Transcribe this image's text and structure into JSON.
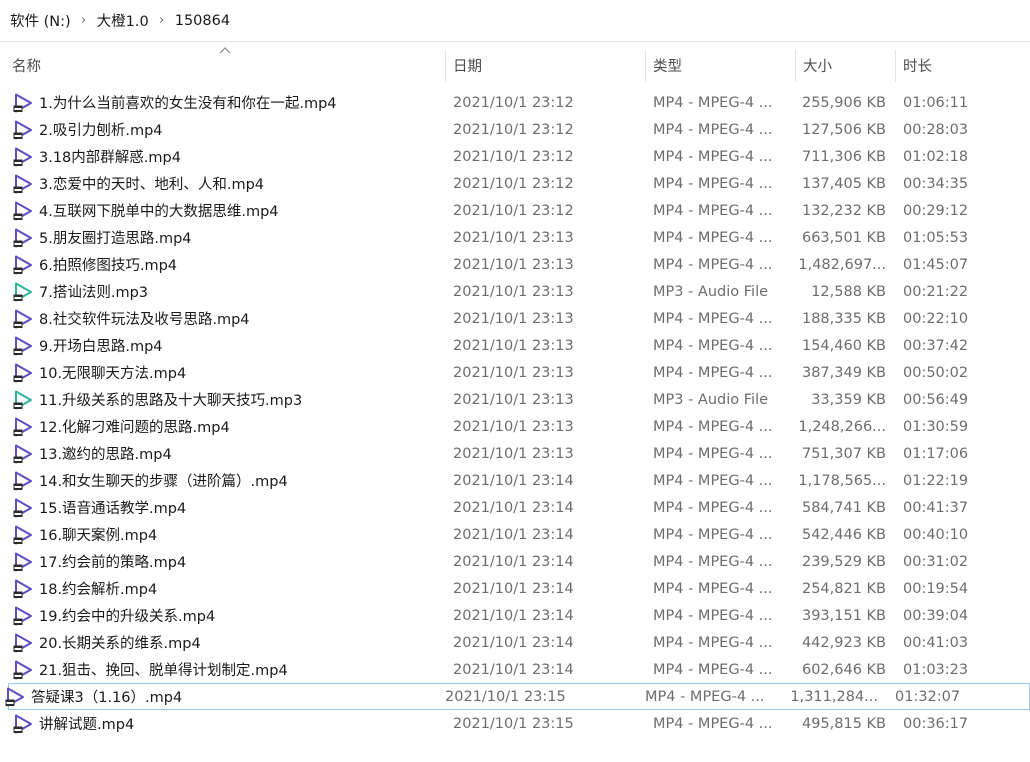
{
  "breadcrumb": [
    "软件 (N:)",
    "大橙1.0",
    "150864"
  ],
  "columns": {
    "name": "名称",
    "date": "日期",
    "type": "类型",
    "size": "大小",
    "duration": "时长"
  },
  "colors": {
    "video_icon": "#5b4fc2",
    "audio_icon": "#2bb39b",
    "focus_outline": "#99c9ef"
  },
  "files": [
    {
      "name": "1.为什么当前喜欢的女生没有和你在一起.mp4",
      "date": "2021/10/1 23:12",
      "type": "MP4 - MPEG-4 ...",
      "size": "255,906 KB",
      "duration": "01:06:11",
      "icon": "video-file-icon"
    },
    {
      "name": "2.吸引力刨析.mp4",
      "date": "2021/10/1 23:12",
      "type": "MP4 - MPEG-4 ...",
      "size": "127,506 KB",
      "duration": "00:28:03",
      "icon": "video-file-icon"
    },
    {
      "name": "3.18内部群解惑.mp4",
      "date": "2021/10/1 23:12",
      "type": "MP4 - MPEG-4 ...",
      "size": "711,306 KB",
      "duration": "01:02:18",
      "icon": "video-file-icon"
    },
    {
      "name": "3.恋爱中的天时、地利、人和.mp4",
      "date": "2021/10/1 23:12",
      "type": "MP4 - MPEG-4 ...",
      "size": "137,405 KB",
      "duration": "00:34:35",
      "icon": "video-file-icon"
    },
    {
      "name": "4.互联网下脱单中的大数据思维.mp4",
      "date": "2021/10/1 23:12",
      "type": "MP4 - MPEG-4 ...",
      "size": "132,232 KB",
      "duration": "00:29:12",
      "icon": "video-file-icon"
    },
    {
      "name": "5.朋友圈打造思路.mp4",
      "date": "2021/10/1 23:13",
      "type": "MP4 - MPEG-4 ...",
      "size": "663,501 KB",
      "duration": "01:05:53",
      "icon": "video-file-icon"
    },
    {
      "name": "6.拍照修图技巧.mp4",
      "date": "2021/10/1 23:13",
      "type": "MP4 - MPEG-4 ...",
      "size": "1,482,697...",
      "duration": "01:45:07",
      "icon": "video-file-icon"
    },
    {
      "name": "7.搭讪法则.mp3",
      "date": "2021/10/1 23:13",
      "type": "MP3 - Audio File",
      "size": "12,588 KB",
      "duration": "00:21:22",
      "icon": "audio-file-icon"
    },
    {
      "name": "8.社交软件玩法及收号思路.mp4",
      "date": "2021/10/1 23:13",
      "type": "MP4 - MPEG-4 ...",
      "size": "188,335 KB",
      "duration": "00:22:10",
      "icon": "video-file-icon"
    },
    {
      "name": "9.开场白思路.mp4",
      "date": "2021/10/1 23:13",
      "type": "MP4 - MPEG-4 ...",
      "size": "154,460 KB",
      "duration": "00:37:42",
      "icon": "video-file-icon"
    },
    {
      "name": "10.无限聊天方法.mp4",
      "date": "2021/10/1 23:13",
      "type": "MP4 - MPEG-4 ...",
      "size": "387,349 KB",
      "duration": "00:50:02",
      "icon": "video-file-icon"
    },
    {
      "name": "11.升级关系的思路及十大聊天技巧.mp3",
      "date": "2021/10/1 23:13",
      "type": "MP3 - Audio File",
      "size": "33,359 KB",
      "duration": "00:56:49",
      "icon": "audio-file-icon"
    },
    {
      "name": "12.化解刁难问题的思路.mp4",
      "date": "2021/10/1 23:13",
      "type": "MP4 - MPEG-4 ...",
      "size": "1,248,266...",
      "duration": "01:30:59",
      "icon": "video-file-icon"
    },
    {
      "name": "13.邀约的思路.mp4",
      "date": "2021/10/1 23:13",
      "type": "MP4 - MPEG-4 ...",
      "size": "751,307 KB",
      "duration": "01:17:06",
      "icon": "video-file-icon"
    },
    {
      "name": "14.和女生聊天的步骤（进阶篇）.mp4",
      "date": "2021/10/1 23:14",
      "type": "MP4 - MPEG-4 ...",
      "size": "1,178,565...",
      "duration": "01:22:19",
      "icon": "video-file-icon"
    },
    {
      "name": "15.语音通话教学.mp4",
      "date": "2021/10/1 23:14",
      "type": "MP4 - MPEG-4 ...",
      "size": "584,741 KB",
      "duration": "00:41:37",
      "icon": "video-file-icon"
    },
    {
      "name": "16.聊天案例.mp4",
      "date": "2021/10/1 23:14",
      "type": "MP4 - MPEG-4 ...",
      "size": "542,446 KB",
      "duration": "00:40:10",
      "icon": "video-file-icon"
    },
    {
      "name": "17.约会前的策略.mp4",
      "date": "2021/10/1 23:14",
      "type": "MP4 - MPEG-4 ...",
      "size": "239,529 KB",
      "duration": "00:31:02",
      "icon": "video-file-icon"
    },
    {
      "name": "18.约会解析.mp4",
      "date": "2021/10/1 23:14",
      "type": "MP4 - MPEG-4 ...",
      "size": "254,821 KB",
      "duration": "00:19:54",
      "icon": "video-file-icon"
    },
    {
      "name": "19.约会中的升级关系.mp4",
      "date": "2021/10/1 23:14",
      "type": "MP4 - MPEG-4 ...",
      "size": "393,151 KB",
      "duration": "00:39:04",
      "icon": "video-file-icon"
    },
    {
      "name": "20.长期关系的维系.mp4",
      "date": "2021/10/1 23:14",
      "type": "MP4 - MPEG-4 ...",
      "size": "442,923 KB",
      "duration": "00:41:03",
      "icon": "video-file-icon"
    },
    {
      "name": "21.狙击、挽回、脱单得计划制定.mp4",
      "date": "2021/10/1 23:14",
      "type": "MP4 - MPEG-4 ...",
      "size": "602,646 KB",
      "duration": "01:03:23",
      "icon": "video-file-icon"
    },
    {
      "name": "答疑课3（1.16）.mp4",
      "date": "2021/10/1 23:15",
      "type": "MP4 - MPEG-4 ...",
      "size": "1,311,284...",
      "duration": "01:32:07",
      "icon": "video-file-icon",
      "focused": true
    },
    {
      "name": "讲解试题.mp4",
      "date": "2021/10/1 23:15",
      "type": "MP4 - MPEG-4 ...",
      "size": "495,815 KB",
      "duration": "00:36:17",
      "icon": "video-file-icon"
    }
  ]
}
